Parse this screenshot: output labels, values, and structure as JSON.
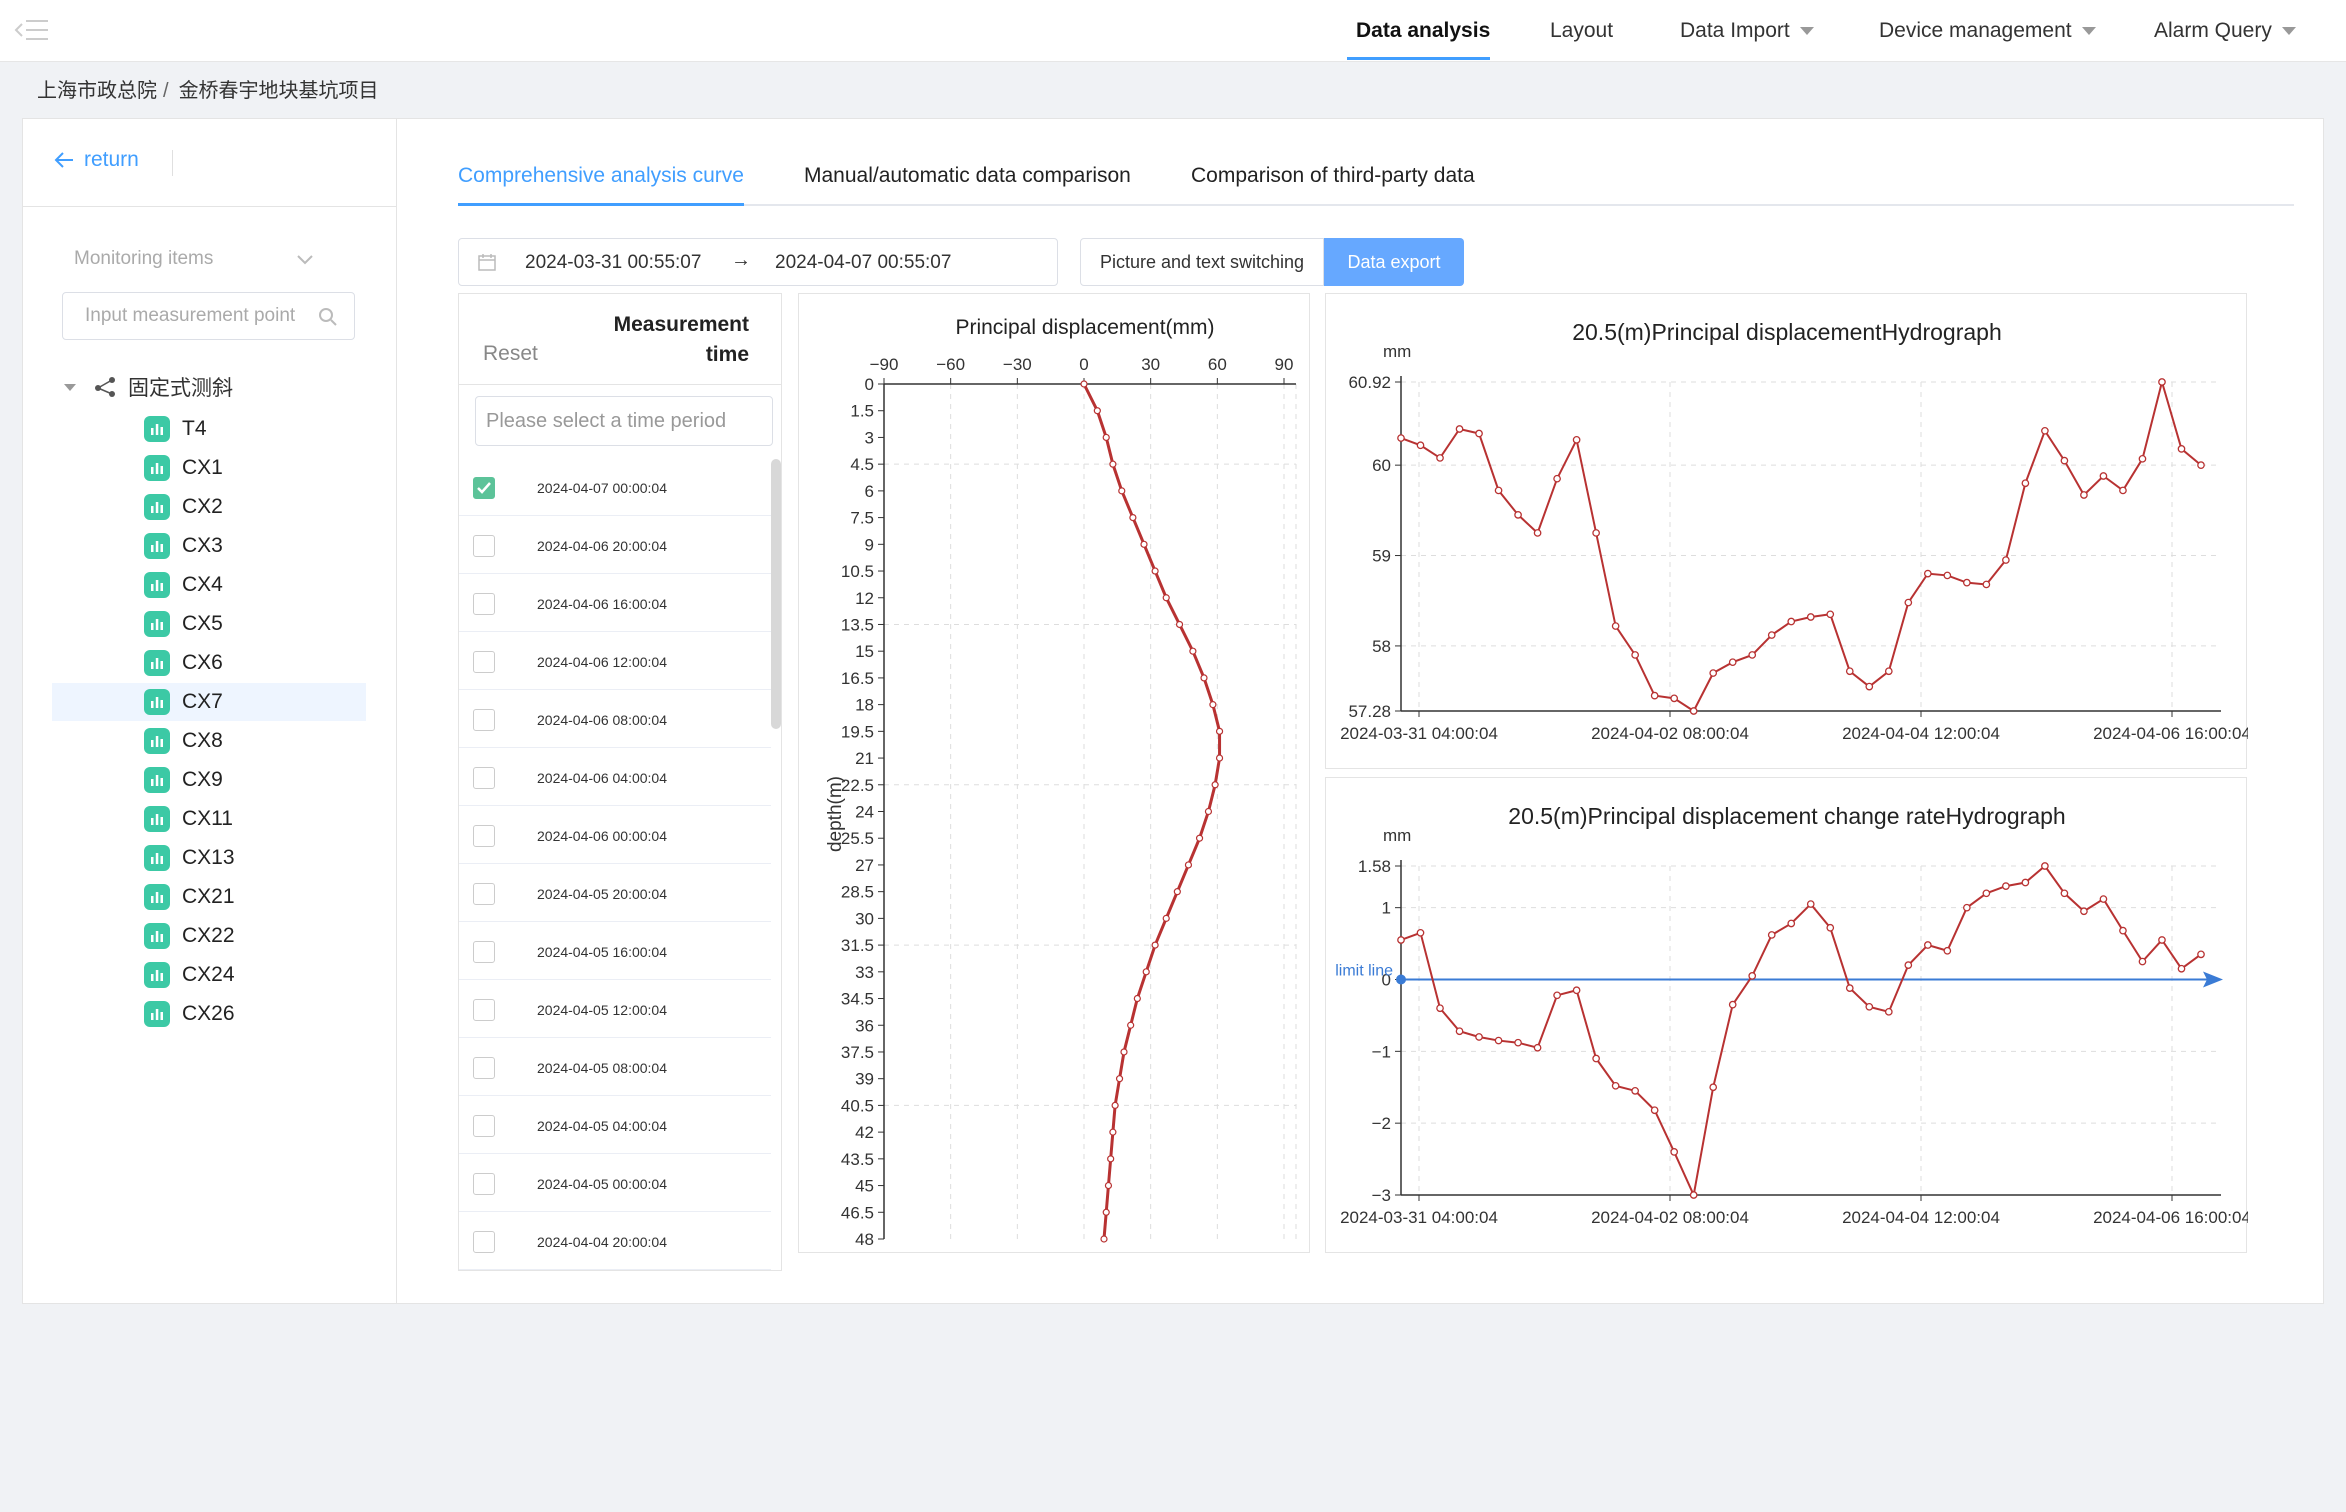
{
  "nav": {
    "items": [
      {
        "label": "Data analysis",
        "active": true,
        "dropdown": false
      },
      {
        "label": "Layout",
        "active": false,
        "dropdown": false
      },
      {
        "label": "Data Import",
        "active": false,
        "dropdown": true
      },
      {
        "label": "Device management",
        "active": false,
        "dropdown": true
      },
      {
        "label": "Alarm Query",
        "active": false,
        "dropdown": true
      }
    ]
  },
  "breadcrumb": [
    "上海市政总院",
    "金桥春宇地块基坑项目"
  ],
  "breadcrumb_sep": "/",
  "sidebar": {
    "return_label": "return",
    "monitor_select": "Monitoring items",
    "search_placeholder": "Input measurement point",
    "tree_root": "固定式测斜",
    "points": [
      "T4",
      "CX1",
      "CX2",
      "CX3",
      "CX4",
      "CX5",
      "CX6",
      "CX7",
      "CX8",
      "CX9",
      "CX11",
      "CX13",
      "CX21",
      "CX22",
      "CX24",
      "CX26"
    ],
    "selected": "CX7"
  },
  "tabs": [
    {
      "label": "Comprehensive analysis curve",
      "active": true
    },
    {
      "label": "Manual/automatic data comparison",
      "active": false
    },
    {
      "label": "Comparison of third-party data",
      "active": false
    }
  ],
  "toolbar": {
    "start": "2024-03-31 00:55:07",
    "arrow": "→",
    "end": "2024-04-07 00:55:07",
    "switch_label": "Picture and text switching",
    "export_label": "Data export"
  },
  "time_panel": {
    "reset": "Reset",
    "title_line1": "Measurement",
    "title_line2": "time",
    "placeholder": "Please select a time period",
    "rows": [
      {
        "time": "2024-04-07 00:00:04",
        "checked": true
      },
      {
        "time": "2024-04-06 20:00:04",
        "checked": false
      },
      {
        "time": "2024-04-06 16:00:04",
        "checked": false
      },
      {
        "time": "2024-04-06 12:00:04",
        "checked": false
      },
      {
        "time": "2024-04-06 08:00:04",
        "checked": false
      },
      {
        "time": "2024-04-06 04:00:04",
        "checked": false
      },
      {
        "time": "2024-04-06 00:00:04",
        "checked": false
      },
      {
        "time": "2024-04-05 20:00:04",
        "checked": false
      },
      {
        "time": "2024-04-05 16:00:04",
        "checked": false
      },
      {
        "time": "2024-04-05 12:00:04",
        "checked": false
      },
      {
        "time": "2024-04-05 08:00:04",
        "checked": false
      },
      {
        "time": "2024-04-05 04:00:04",
        "checked": false
      },
      {
        "time": "2024-04-05 00:00:04",
        "checked": false
      },
      {
        "time": "2024-04-04 20:00:04",
        "checked": false
      }
    ]
  },
  "colors": {
    "accent": "#409eff",
    "series": "#b83232",
    "tree_icon": "#3cc9a5",
    "export_btn": "#66a8ff",
    "zero_line": "#3a7bd5"
  },
  "chart_data": [
    {
      "type": "line",
      "title": "Principal displacement(mm)",
      "xlabel": "",
      "ylabel": "depth(m)",
      "orientation": "vertical-profile",
      "xlim": [
        -90,
        90
      ],
      "xticks": [
        -90,
        -60,
        -30,
        0,
        30,
        60,
        90
      ],
      "ylim": [
        0,
        48
      ],
      "yticks": [
        0,
        1.5,
        3,
        4.5,
        6,
        7.5,
        9,
        10.5,
        12,
        13.5,
        15,
        16.5,
        18,
        19.5,
        21,
        22.5,
        24,
        25.5,
        27,
        28.5,
        30,
        31.5,
        33,
        34.5,
        36,
        37.5,
        39,
        40.5,
        42,
        43.5,
        45,
        46.5,
        48
      ],
      "y_inverted": true,
      "grid": true,
      "depth": [
        0,
        1.5,
        3,
        4.5,
        6,
        7.5,
        9,
        10.5,
        12,
        13.5,
        15,
        16.5,
        18,
        19.5,
        21,
        22.5,
        24,
        25.5,
        27,
        28.5,
        30,
        31.5,
        33,
        34.5,
        36,
        37.5,
        39,
        40.5,
        42,
        43.5,
        45,
        46.5,
        48
      ],
      "displacement": [
        0,
        6,
        10,
        13,
        17,
        22,
        27,
        32,
        37,
        43,
        49,
        54,
        58,
        61,
        61,
        59,
        56,
        52,
        47,
        42,
        37,
        32,
        28,
        24,
        21,
        18,
        16,
        14,
        13,
        12,
        11,
        10,
        9
      ]
    },
    {
      "type": "line",
      "title": "20.5(m)Principal displacementHydrograph",
      "ylabel": "mm",
      "ylim": [
        57.28,
        60.92
      ],
      "yticks": [
        57.28,
        58,
        59,
        60,
        60.92
      ],
      "xticks": [
        "2024-03-31 04:00:04",
        "2024-04-02 08:00:04",
        "2024-04-04 12:00:04",
        "2024-04-06 16:00:04"
      ],
      "grid": true,
      "values": [
        60.3,
        60.22,
        60.08,
        60.4,
        60.35,
        59.72,
        59.45,
        59.25,
        59.85,
        60.28,
        59.25,
        58.22,
        57.9,
        57.45,
        57.42,
        57.28,
        57.7,
        57.82,
        57.9,
        58.12,
        58.27,
        58.32,
        58.35,
        57.72,
        57.55,
        57.72,
        58.48,
        58.8,
        58.78,
        58.7,
        58.68,
        58.95,
        59.8,
        60.38,
        60.05,
        59.67,
        59.88,
        59.72,
        60.07,
        60.92,
        60.18,
        60
      ]
    },
    {
      "type": "line",
      "title": "20.5(m)Principal displacement change rateHydrograph",
      "ylabel": "mm",
      "ylim": [
        -3,
        1.58
      ],
      "yticks": [
        -3,
        -2,
        -1,
        0,
        1,
        1.58
      ],
      "xticks": [
        "2024-03-31 04:00:04",
        "2024-04-02 08:00:04",
        "2024-04-04 12:00:04",
        "2024-04-06 16:00:04"
      ],
      "grid": true,
      "zero_line_label": "limit line",
      "values": [
        0.55,
        0.65,
        -0.4,
        -0.72,
        -0.8,
        -0.85,
        -0.88,
        -0.95,
        -0.22,
        -0.15,
        -1.1,
        -1.48,
        -1.55,
        -1.82,
        -2.4,
        -3,
        -1.5,
        -0.35,
        0.05,
        0.62,
        0.78,
        1.05,
        0.72,
        -0.12,
        -0.38,
        -0.45,
        0.2,
        0.48,
        0.4,
        1,
        1.2,
        1.3,
        1.35,
        1.58,
        1.2,
        0.95,
        1.12,
        0.68,
        0.25,
        0.55,
        0.15,
        0.35
      ]
    }
  ]
}
